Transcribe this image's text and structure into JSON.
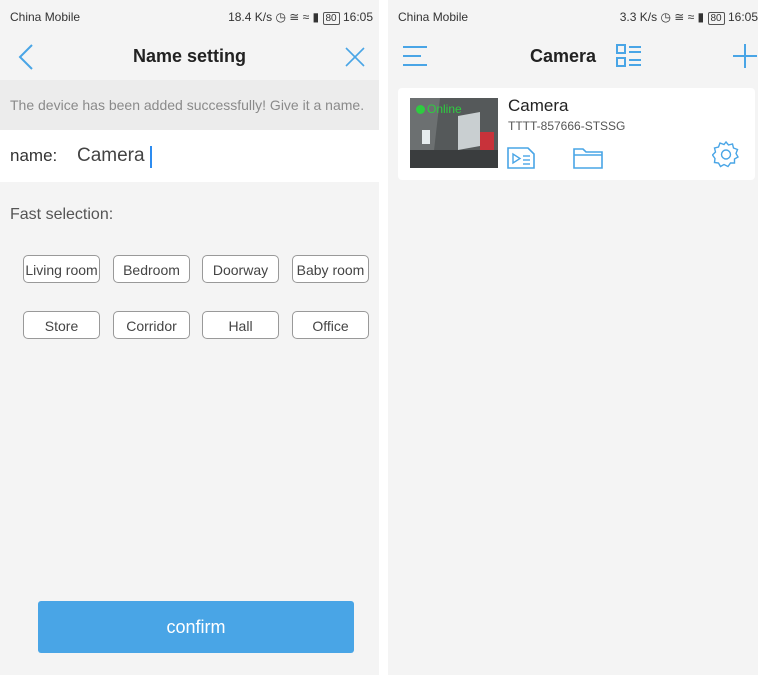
{
  "left": {
    "status": {
      "carrier": "China Mobile",
      "speed": "18.4 K/s",
      "battery": "80",
      "time": "16:05"
    },
    "nav": {
      "title": "Name setting"
    },
    "banner": "The device has been added successfully! Give it a name.",
    "name": {
      "label": "name:",
      "value": "Camera"
    },
    "fast_selection": {
      "title": "Fast selection:",
      "chips": [
        "Living room",
        "Bedroom",
        "Doorway",
        "Baby room",
        "Store",
        "Corridor",
        "Hall",
        "Office"
      ]
    },
    "confirm_label": "confirm"
  },
  "right": {
    "status": {
      "carrier": "China Mobile",
      "speed": "3.3 K/s",
      "battery": "80",
      "time": "16:05"
    },
    "nav": {
      "title": "Camera"
    },
    "device": {
      "status": "Online",
      "name": "Camera",
      "id": "TTTT-857666-STSSG"
    }
  },
  "colors": {
    "accent": "#49a5e6",
    "online": "#2ecc40"
  }
}
